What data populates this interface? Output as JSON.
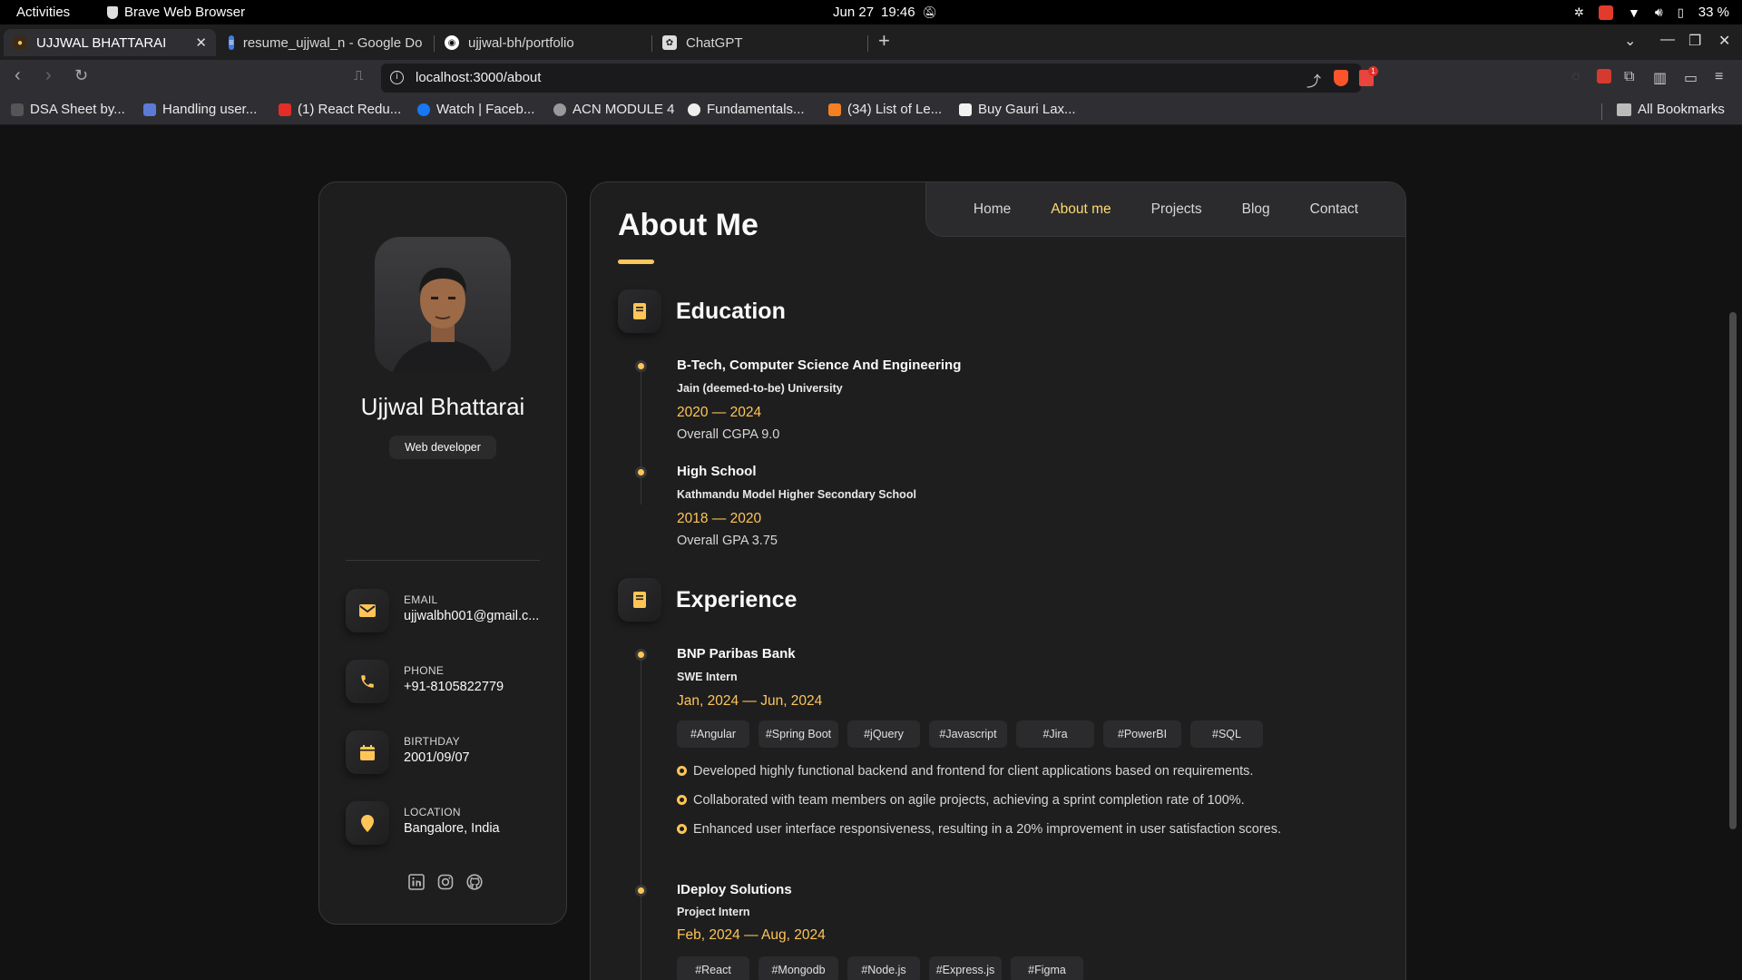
{
  "os": {
    "activities": "Activities",
    "app_name": "Brave Web Browser",
    "date": "Jun 27",
    "time": "19:46",
    "battery": "33 %"
  },
  "tabs": [
    {
      "label": "UJJWAL BHATTARAI"
    },
    {
      "label": "resume_ujjwal_n - Google Do"
    },
    {
      "label": "ujjwal-bh/portfolio"
    },
    {
      "label": "ChatGPT"
    }
  ],
  "toolbar": {
    "url": "localhost:3000/about",
    "notif_count": "1"
  },
  "bookmarks": {
    "items": [
      {
        "label": "DSA Sheet by..."
      },
      {
        "label": "Handling user..."
      },
      {
        "label": "(1) React Redu..."
      },
      {
        "label": "Watch | Faceb..."
      },
      {
        "label": "ACN MODULE 4"
      },
      {
        "label": "Fundamentals..."
      },
      {
        "label": "(34) List of Le..."
      },
      {
        "label": "Buy Gauri Lax..."
      }
    ],
    "all_bookmarks": "All Bookmarks"
  },
  "profile": {
    "name": "Ujjwal Bhattarai",
    "role": "Web developer",
    "contacts": [
      {
        "label": "EMAIL",
        "value": "ujjwalbh001@gmail.c..."
      },
      {
        "label": "PHONE",
        "value": "+91-8105822779"
      },
      {
        "label": "BIRTHDAY",
        "value": "2001/09/07"
      },
      {
        "label": "LOCATION",
        "value": "Bangalore, India"
      }
    ]
  },
  "nav": {
    "items": [
      "Home",
      "About me",
      "Projects",
      "Blog",
      "Contact"
    ],
    "active": "About me"
  },
  "about": {
    "title": "About Me",
    "education": {
      "title": "Education",
      "items": [
        {
          "degree": "B-Tech, Computer Science And Engineering",
          "school": "Jain (deemed-to-be) University",
          "dates": "2020 — 2024",
          "grade": "Overall CGPA 9.0"
        },
        {
          "degree": "High School",
          "school": "Kathmandu Model Higher Secondary School",
          "dates": "2018 — 2020",
          "grade": "Overall GPA 3.75"
        }
      ]
    },
    "experience": {
      "title": "Experience",
      "items": [
        {
          "company": "BNP Paribas Bank",
          "role": "SWE Intern",
          "dates": "Jan, 2024 — Jun, 2024",
          "tags": [
            "#Angular",
            "#Spring Boot",
            "#jQuery",
            "#Javascript",
            "#Jira",
            "#PowerBI",
            "#SQL"
          ],
          "bullets": [
            "Developed highly functional backend and frontend for client applications based on requirements.",
            "Collaborated with team members on agile projects, achieving a sprint completion rate of 100%.",
            "Enhanced user interface responsiveness, resulting in a 20% improvement in user satisfaction scores."
          ]
        },
        {
          "company": "IDeploy Solutions",
          "role": "Project Intern",
          "dates": "Feb, 2024 — Aug, 2024",
          "tags": [
            "#React",
            "#Mongodb",
            "#Node.js",
            "#Express.js",
            "#Figma"
          ]
        }
      ]
    }
  },
  "colors": {
    "accent": "#ffc557",
    "accent_light": "#ffdb70",
    "card_bg": "#1e1e1f",
    "page_bg": "#121212"
  }
}
